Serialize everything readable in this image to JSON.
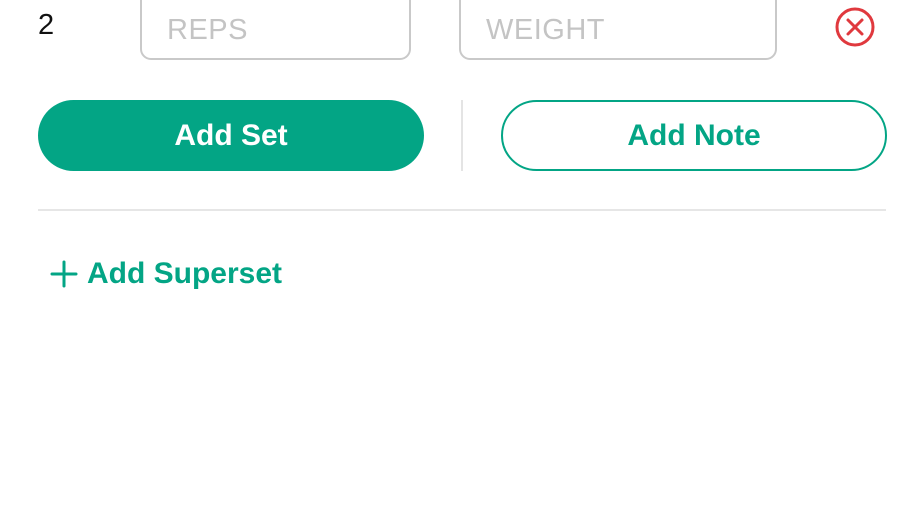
{
  "set_row": {
    "set_number": "2",
    "reps_placeholder": "REPS",
    "reps_value": "",
    "weight_placeholder": "WEIGHT",
    "weight_value": "",
    "remove_icon": "close-circle-icon"
  },
  "actions": {
    "add_set_label": "Add Set",
    "add_note_label": "Add Note"
  },
  "superset": {
    "icon": "plus-icon",
    "label": "Add Superset"
  },
  "colors": {
    "accent": "#03a585",
    "danger": "#e0393e",
    "field_border": "#c9c9c9",
    "divider": "#e6e6e6"
  }
}
